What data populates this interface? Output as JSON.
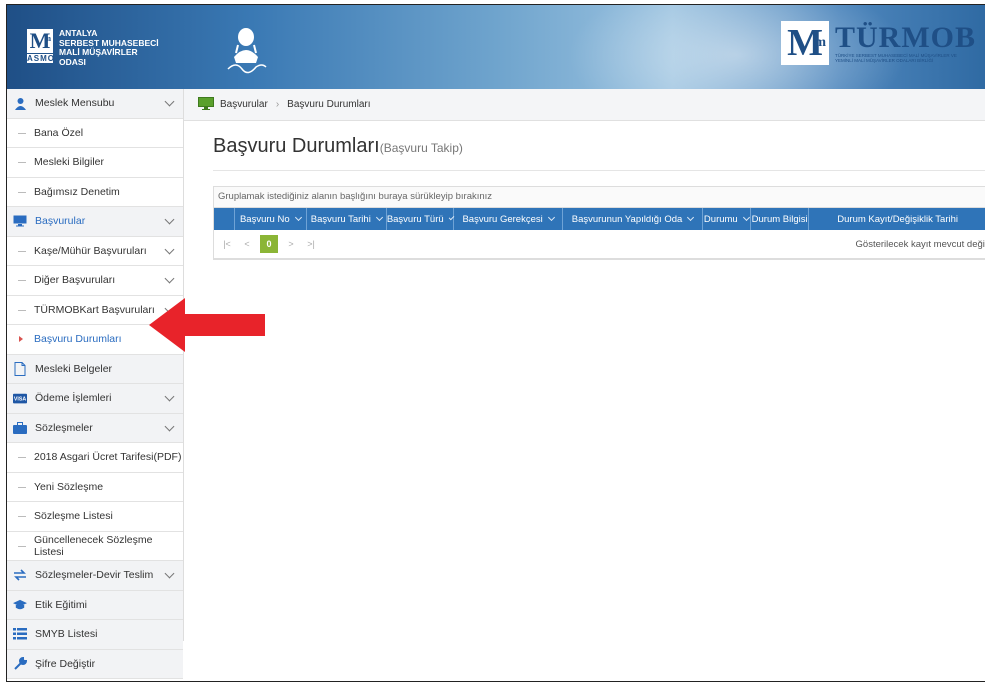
{
  "header": {
    "org_lines": [
      "ANTALYA",
      "SERBEST MUHASEBECİ",
      "MALİ MÜŞAVİRLER",
      "ODASI"
    ],
    "asmo": "ASMO",
    "brand": "TÜRMOB",
    "brand_sub": "TÜRKİYE SERBEST MUHASEBECİ MALİ MÜŞAVİRLER VE YEMİNLİ MALİ MÜŞAVİRLER ODALARI BİRLİĞİ",
    "logo_letter": "M",
    "logo_sup": "m"
  },
  "sidebar": {
    "items": [
      {
        "label": "Meslek Mensubu",
        "type": "top",
        "icon": "user-icon",
        "chevron": true
      },
      {
        "label": "Bana Özel",
        "type": "sub"
      },
      {
        "label": "Mesleki Bilgiler",
        "type": "sub"
      },
      {
        "label": "Bağımsız Denetim",
        "type": "sub"
      },
      {
        "label": "Başvurular",
        "type": "top",
        "icon": "monitor-icon",
        "chevron": true,
        "blue": true
      },
      {
        "label": "Kaşe/Mühür Başvuruları",
        "type": "sub",
        "chevron": true
      },
      {
        "label": "Diğer Başvuruları",
        "type": "sub",
        "chevron": true
      },
      {
        "label": "TÜRMOBKart Başvuruları",
        "type": "sub",
        "chevron": true
      },
      {
        "label": "Başvuru Durumları",
        "type": "sub",
        "active": true
      },
      {
        "label": "Mesleki Belgeler",
        "type": "top",
        "icon": "document-icon"
      },
      {
        "label": "Ödeme İşlemleri",
        "type": "top",
        "icon": "visa-card-icon",
        "chevron": true
      },
      {
        "label": "Sözleşmeler",
        "type": "top",
        "icon": "briefcase-icon",
        "chevron": true
      },
      {
        "label": "2018 Asgari Ücret Tarifesi(PDF)",
        "type": "sub"
      },
      {
        "label": "Yeni Sözleşme",
        "type": "sub"
      },
      {
        "label": "Sözleşme Listesi",
        "type": "sub"
      },
      {
        "label": "Güncellenecek Sözleşme Listesi",
        "type": "sub"
      },
      {
        "label": "Sözleşmeler-Devir Teslim",
        "type": "top",
        "icon": "exchange-icon",
        "chevron": true
      },
      {
        "label": "Etik Eğitimi",
        "type": "top",
        "icon": "graduation-cap-icon"
      },
      {
        "label": "SMYB Listesi",
        "type": "top",
        "icon": "list-icon"
      },
      {
        "label": "Şifre Değiştir",
        "type": "top",
        "icon": "wrench-icon"
      }
    ]
  },
  "breadcrumb": {
    "root": "Başvurular",
    "current": "Başvuru Durumları"
  },
  "page": {
    "title": "Başvuru Durumları",
    "subtitle": "(Başvuru Takip)"
  },
  "grid": {
    "group_hint": "Gruplamak istediğiniz alanın başlığını buraya sürükleyip bırakınız",
    "columns": [
      {
        "label": "Başvuru No",
        "sortable": true
      },
      {
        "label": "Başvuru Tarihi",
        "sortable": true
      },
      {
        "label": "Başvuru Türü",
        "sortable": true
      },
      {
        "label": "Başvuru Gerekçesi",
        "sortable": true
      },
      {
        "label": "Başvurunun Yapıldığı Oda",
        "sortable": true
      },
      {
        "label": "Durumu",
        "sortable": true
      },
      {
        "label": "Durum Bilgisi",
        "sortable": false
      },
      {
        "label": "Durum Kayıt/Değişiklik Tarihi",
        "sortable": false
      }
    ],
    "pager": {
      "first": "|<",
      "prev": "<",
      "current": "0",
      "next": ">",
      "last": ">|"
    },
    "no_records": "Gösterilecek kayıt mevcut değil"
  },
  "colors": {
    "header_blue": "#2f74b8",
    "pager_active": "#8bb536",
    "arrow_red": "#e8232a",
    "link_blue": "#2a6cc0"
  }
}
